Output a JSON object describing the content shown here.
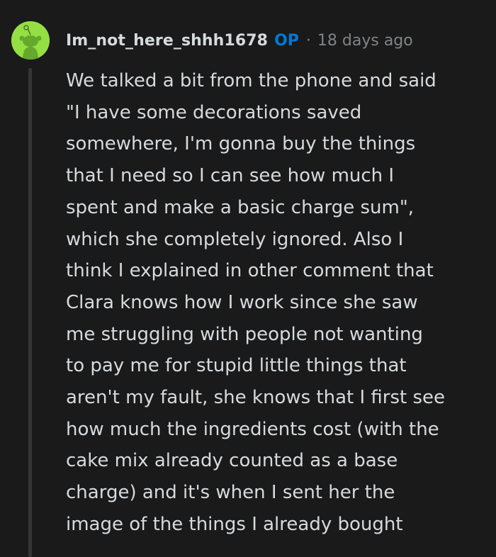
{
  "comment": {
    "avatar_icon": "snoo-avatar-icon",
    "avatar_color": "#94e044",
    "author": "Im_not_here_shhh1678",
    "op_badge": "OP",
    "separator": "·",
    "timestamp": "18 days ago",
    "accent_color": "#0079d3",
    "body_lines": [
      "We talked a bit from the phone and said",
      "\"I have some decorations saved",
      "somewhere, I'm gonna buy the things",
      "that I need so I can see how much I",
      "spent and make a basic charge sum\",",
      "which she completely ignored. Also I",
      "think I explained in other comment that",
      "Clara knows how I work since she saw",
      "me struggling with people not wanting",
      "to pay me for stupid little things that",
      "aren't my fault, she knows that I first see",
      "how much the ingredients cost (with the",
      "cake mix already counted as a base",
      "charge) and it's when I sent her the",
      "image of the things I already bought"
    ]
  }
}
